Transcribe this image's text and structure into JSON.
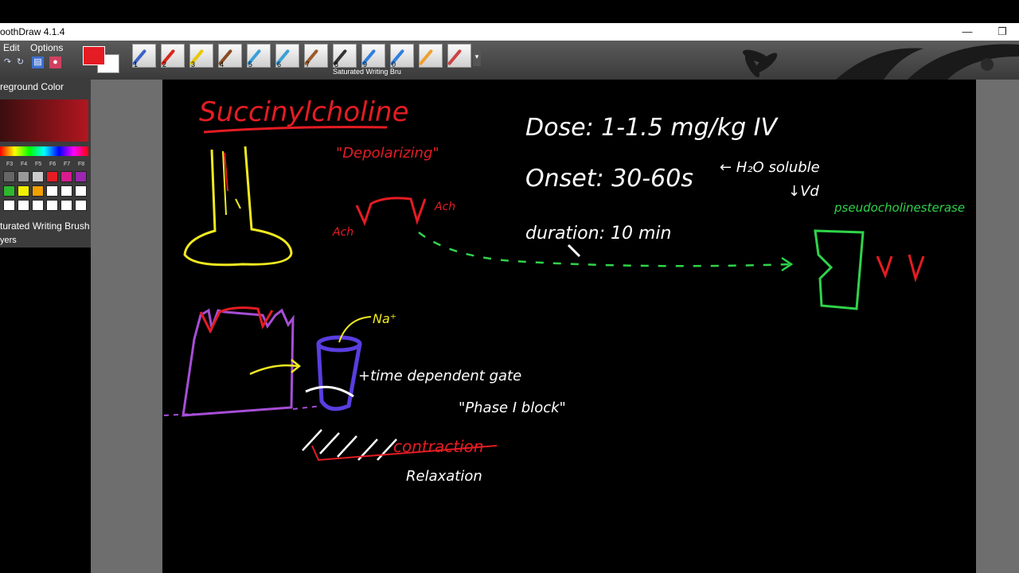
{
  "app": {
    "title": "oothDraw 4.1.4",
    "minimize_glyph": "—",
    "restore_glyph": "❐"
  },
  "menu": {
    "edit": "Edit",
    "options": "Options"
  },
  "colors": {
    "foreground": "#e51c23",
    "background": "#ffffff"
  },
  "brushes": [
    {
      "num": "1",
      "color": "#3b63c6"
    },
    {
      "num": "2",
      "color": "#d9261c"
    },
    {
      "num": "3",
      "color": "#e6c800"
    },
    {
      "num": "4",
      "color": "#8a4b1f"
    },
    {
      "num": "5",
      "color": "#3aa0d8"
    },
    {
      "num": "6",
      "color": "#3aa0d8"
    },
    {
      "num": "7",
      "color": "#9b5a2a"
    },
    {
      "num": "8",
      "color": "#333333"
    },
    {
      "num": "9",
      "color": "#2f7fe0"
    },
    {
      "num": "0",
      "color": "#2f7fe0"
    },
    {
      "num": "",
      "color": "#f0a030"
    },
    {
      "num": "",
      "color": "#cc4444"
    }
  ],
  "brush_caption": "Saturated Writing Bru",
  "panel": {
    "foreground_title": "reground Color",
    "fkeys": [
      "F3",
      "F4",
      "F5",
      "F6",
      "F7",
      "F8"
    ],
    "palette_colors": [
      "#666666",
      "#999999",
      "#cccccc",
      "#e51c23",
      "#d81b8f",
      "#9c27b0",
      "#2eb82e",
      "#f0f000",
      "#f0a000",
      "#ffffff",
      "#ffffff",
      "#ffffff",
      "#ffffff",
      "#ffffff",
      "#ffffff",
      "#ffffff",
      "#ffffff",
      "#ffffff"
    ],
    "current_brush": "turated Writing Brush",
    "layers": "yers"
  },
  "canvas_notes": {
    "title": "Succinylcholine",
    "depolarizing": "\"Depolarizing\"",
    "dose": "Dose: 1-1.5 mg/kg IV",
    "onset": "Onset: 30-60s",
    "h2o": "← H₂O soluble",
    "vd": "↓Vd",
    "duration": "duration: 10 min",
    "pseudo": "pseudocholinesterase",
    "ach_right": "Ach",
    "ach_left": "Ach",
    "na": "Na⁺",
    "time_gate": "+time dependent gate",
    "phase": "\"Phase I block\"",
    "contraction": "contraction",
    "relaxation": "Relaxation"
  }
}
